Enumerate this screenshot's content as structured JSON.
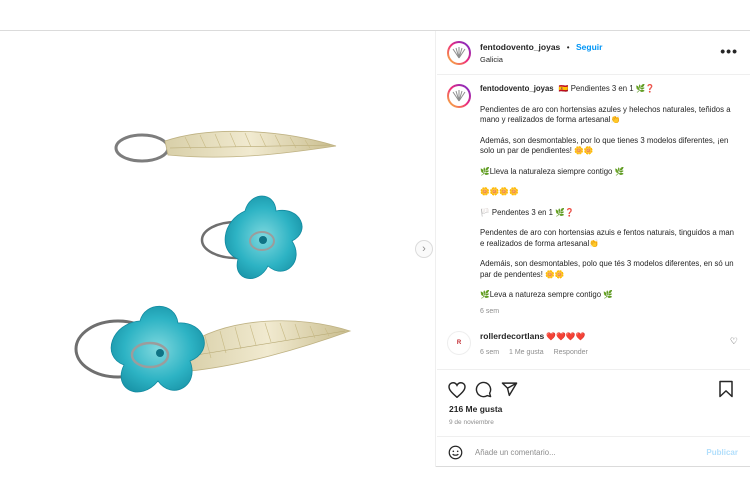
{
  "post": {
    "username": "fentodovento_joyas",
    "follow_label": "Seguir",
    "location": "Galicia",
    "more_icon": "more-horizontal-icon"
  },
  "caption": {
    "username": "fentodovento_joyas",
    "title": "🇪🇸 Pendientes 3 en 1 🌿❓",
    "paragraphs": [
      "Pendientes de aro con hortensias azules y helechos naturales, teñidos a mano y realizados de forma artesanal👏",
      "Además, son desmontables, por lo que tienes 3 modelos diferentes, ¡en solo un par de pendientes! 🌼🌼",
      "🌿Lleva la naturaleza siempre contigo 🌿",
      "🌼🌼🌼🌼",
      "🏳️ Pendentes 3 en 1 🌿❓",
      "Pendentes de aro con hortensias azuis e fentos naturais, tinguidos a man e realizados de forma artesanal👏",
      "Ademáis, son desmontables, polo que tés 3 modelos diferentes, en só un par de pendentes! 🌼🌼",
      "🌿Leva a natureza sempre contigo 🌿"
    ],
    "time": "6 sem"
  },
  "comment": {
    "username": "rollerdecortlans",
    "text": "❤️❤️❤️❤️",
    "time": "6 sem",
    "likes": "1 Me gusta",
    "reply": "Responder",
    "avatar_text": "R"
  },
  "stats": {
    "likes": "216 Me gusta",
    "date": "9 de noviembre"
  },
  "add_comment": {
    "placeholder": "Añade un comentario...",
    "publish": "Publicar"
  },
  "colors": {
    "accent": "#0095f6",
    "turquoise": "#2fb9c8",
    "gold": "#e8dcb0"
  }
}
